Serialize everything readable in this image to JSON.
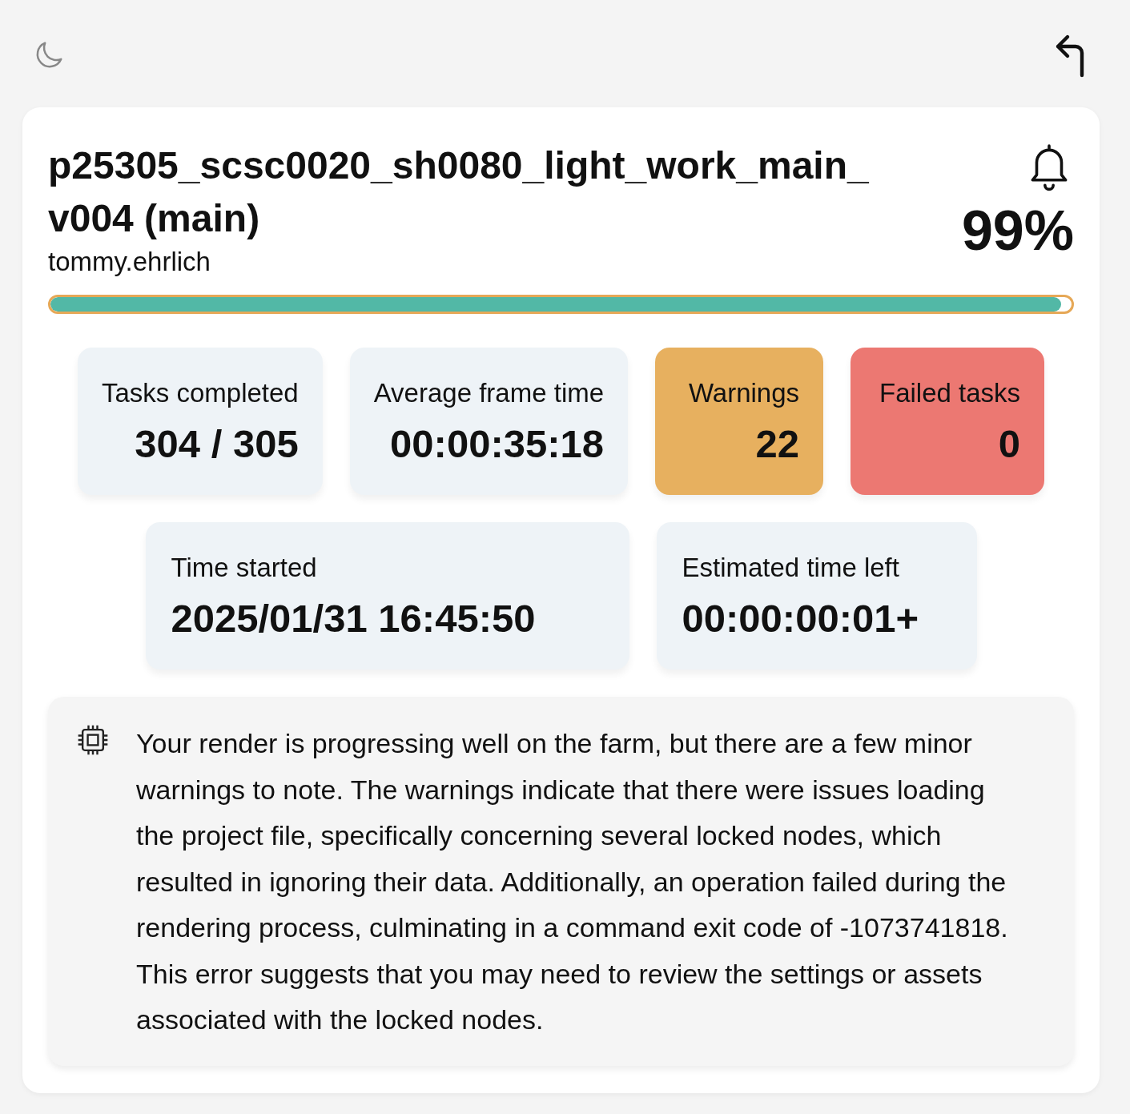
{
  "job": {
    "title": "p25305_scsc0020_sh0080_light_work_main_v004 (main)",
    "user": "tommy.ehrlich",
    "percent": "99%",
    "level": 0.99
  },
  "stats": [
    {
      "label": "Tasks completed",
      "value": "304 / 305",
      "color": "#eef3f7"
    },
    {
      "label": "Average frame time",
      "value": "00:00:35:18",
      "color": "#eef3f7"
    },
    {
      "label": "Warnings",
      "value": "22",
      "color": "#e7b05f"
    },
    {
      "label": "Failed tasks",
      "value": "0",
      "color": "#ec7872"
    },
    {
      "label": "Time started",
      "value": "2025/01/31 16:45:50",
      "color": "#eef3f7"
    },
    {
      "label": "Estimated time left",
      "value": "00:00:00:01+",
      "color": "#eef3f7"
    }
  ],
  "summary": "Your render is progressing well on the farm, but there are a few minor warnings to note. The warnings indicate that there were issues loading the project file, specifically concerning several locked nodes, which resulted in ignoring their data. Additionally, an operation failed during the rendering process, culminating in a command exit code of -1073741818. This error suggests that you may need to review the settings or assets associated with the locked nodes."
}
